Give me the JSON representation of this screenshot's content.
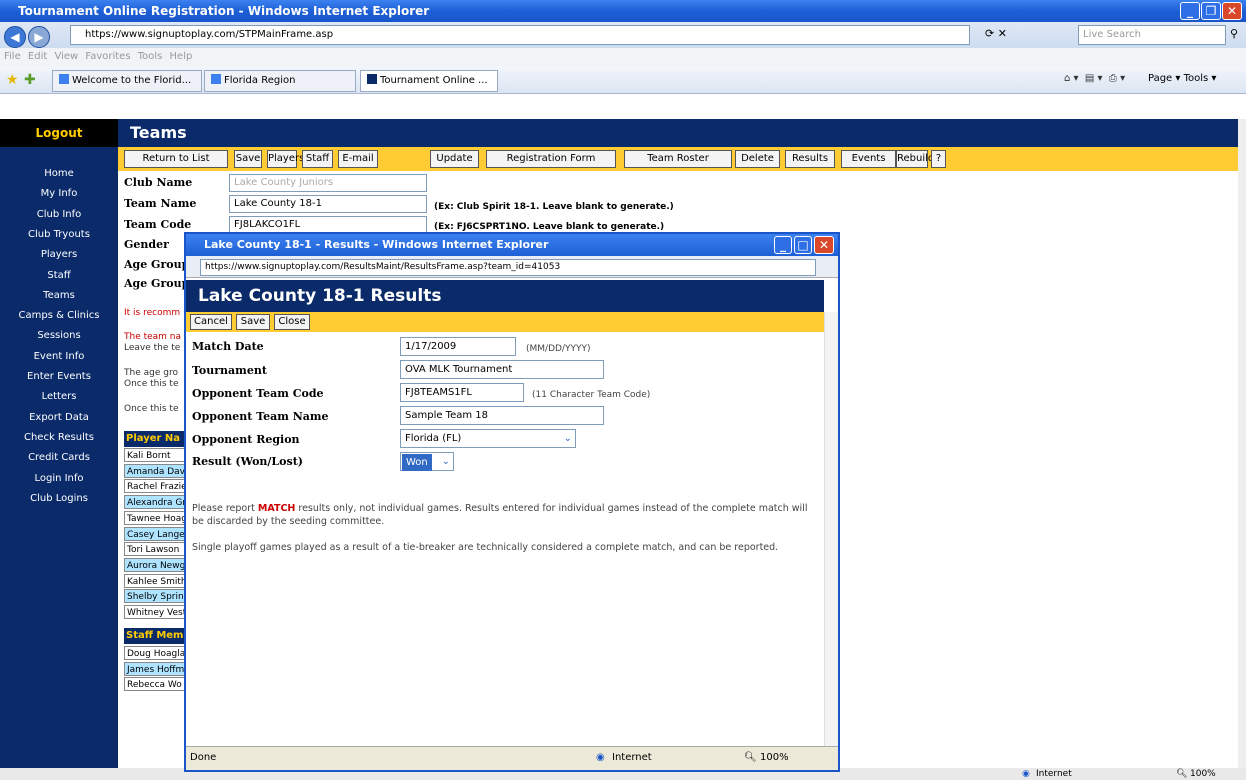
{
  "window": {
    "title": "Tournament Online Registration - Windows Internet Explorer",
    "url": "https://www.signuptoplay.com/STPMainFrame.asp",
    "search_placeholder": "Live Search",
    "menu": "File  Edit  View  Favorites  Tools  Help",
    "tabs": [
      "Welcome to the Florid...",
      "Florida Region",
      "Tournament Online ..."
    ],
    "toolbar_right": "Page ▾  Tools ▾"
  },
  "sidebar": {
    "logout": "Logout",
    "items": [
      "Home",
      "My Info",
      "Club Info",
      "Club Tryouts",
      "Players",
      "Staff",
      "Teams",
      "Camps & Clinics",
      "Sessions",
      "Event Info",
      "Enter Events",
      "Letters",
      "Export Data",
      "Check Results",
      "Credit Cards",
      "Login Info",
      "Club Logins"
    ]
  },
  "page": {
    "title": "Teams",
    "buttons": [
      "Return to List",
      "Save",
      "Players",
      "Staff",
      "E-mail",
      "Update",
      "Registration Form",
      "Team Roster",
      "Delete",
      "Results",
      "Events",
      "Rebuild",
      "?"
    ],
    "club_name_label": "Club Name",
    "club_name_value": "Lake County Juniors",
    "team_name_label": "Team Name",
    "team_name_value": "Lake County 18-1",
    "team_name_hint": "(Ex: Club Spirit 18-1. Leave blank to generate.)",
    "team_code_label": "Team Code",
    "team_code_value": "FJ8LAKCO1FL",
    "team_code_hint": "(Ex: FJ6CSPRT1NO. Leave blank to generate.)",
    "gender_label": "Gender",
    "age_group_label": "Age Group",
    "age_group2_label": "Age Group",
    "recommend_text": "It is recomm",
    "team_na_text": "The team na",
    "leave_text": "Leave the te",
    "age_gro_text": "The age gro",
    "once_text": "Once this te",
    "once2_text": "Once this te",
    "player_header": "Player Na",
    "players": [
      "Kali Bornt",
      "Amanda Davi",
      "Rachel Frazie",
      "Alexandra Gr",
      "Tawnee Hoag",
      "Casey Lange",
      "Tori Lawson",
      "Aurora Newga",
      "Kahlee Smith",
      "Shelby Spring",
      "Whitney Vest"
    ],
    "staff_header": "Staff Mem",
    "staff": [
      "Doug Hoaglar",
      "James Hoffm",
      "Rebecca Wo"
    ]
  },
  "popup": {
    "title": "Lake County 18-1 - Results - Windows Internet Explorer",
    "url": "https://www.signuptoplay.com/ResultsMaint/ResultsFrame.asp?team_id=41053",
    "heading": "Lake County 18-1 Results",
    "buttons": [
      "Cancel",
      "Save",
      "Close"
    ],
    "match_date_label": "Match Date",
    "match_date_value": "1/17/2009",
    "match_date_hint": "(MM/DD/YYYY)",
    "tournament_label": "Tournament",
    "tournament_value": "OVA MLK Tournament",
    "opp_code_label": "Opponent Team Code",
    "opp_code_value": "FJ8TEAMS1FL",
    "opp_code_hint": "(11 Character Team Code)",
    "opp_name_label": "Opponent Team Name",
    "opp_name_value": "Sample Team 18",
    "opp_region_label": "Opponent Region",
    "opp_region_value": "Florida (FL)",
    "result_label": "Result (Won/Lost)",
    "result_value": "Won",
    "note1_pre": "Please report ",
    "note1_match": "MATCH",
    "note1_post": " results only, not individual games. Results entered for individual games instead of the complete match will be discarded by the seeding committee.",
    "note2": "Single playoff games played as a result of a tie-breaker are technically considered a complete match, and can be reported.",
    "status_left": "Done",
    "status_zone": "Internet",
    "status_zoom": "100%"
  },
  "statusbar": {
    "zone": "Internet",
    "zoom": "100%"
  },
  "colors": {
    "navy": "#0a2a6a",
    "yellow": "#ffcc33",
    "ie_blue": "#1e5fd6"
  }
}
